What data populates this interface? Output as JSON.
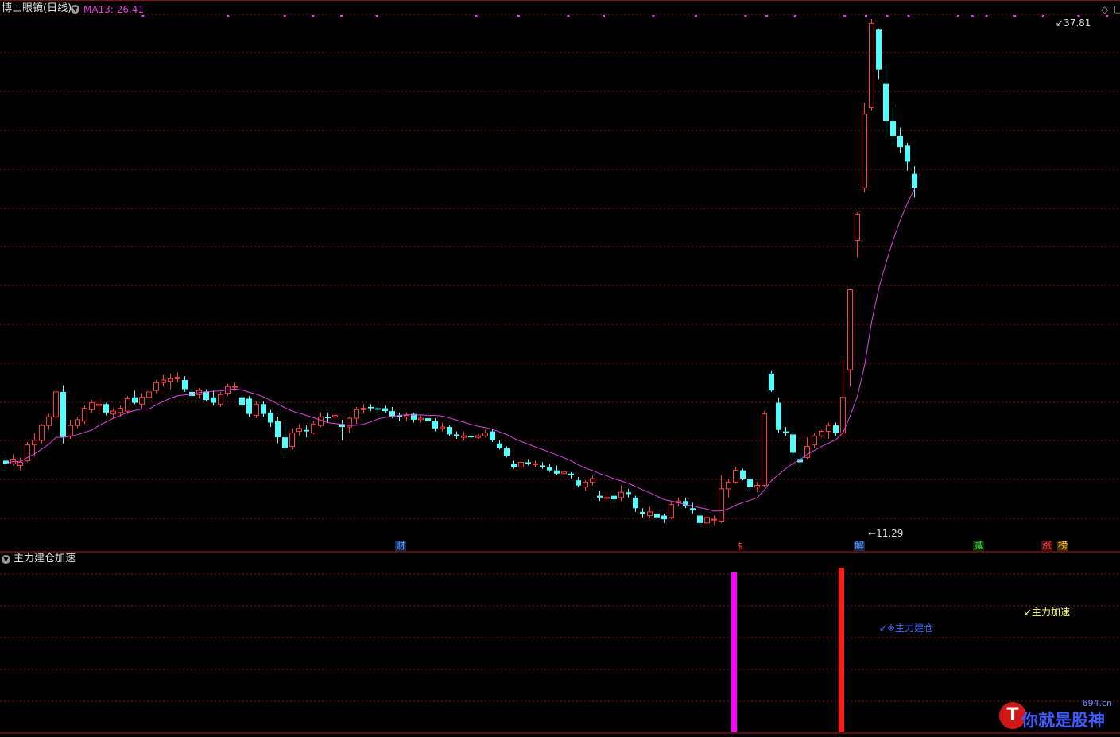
{
  "header": {
    "title": "博士眼镜(日线)",
    "ma_label": "MA13: 26.41",
    "ma_color": "#e040e0"
  },
  "sub_panel": {
    "title": "主力建仓加速"
  },
  "price_labels": {
    "high": "37.81",
    "low": "11.29"
  },
  "event_tags": [
    {
      "id": "cai",
      "text": "财",
      "color": "#5aa0ff",
      "bg": "#1a2a55"
    },
    {
      "id": "dollar",
      "text": "$",
      "color": "#ff3030",
      "bg": "#000000"
    },
    {
      "id": "jie",
      "text": "解",
      "color": "#5aa0ff",
      "bg": "#1a2a55"
    },
    {
      "id": "jian",
      "text": "减",
      "color": "#40e040",
      "bg": "#103010"
    },
    {
      "id": "zhang",
      "text": "涨",
      "color": "#ff4040",
      "bg": "#401010"
    },
    {
      "id": "bang",
      "text": "榜",
      "color": "#ffcc33",
      "bg": "#402a10"
    }
  ],
  "annotations": {
    "jiancang": "↙※主力建仓",
    "jiasu": "↙主力加速"
  },
  "watermark": {
    "main": "你就是股神",
    "site": "694.cn"
  },
  "colors": {
    "up": "#ff3c3c",
    "down": "#54ffff",
    "ma": "#e040e0",
    "grid": "#8a1010",
    "signal_build": "#ff00ff",
    "signal_accel": "#ff1a1a"
  },
  "chart_data": {
    "type": "candlestick",
    "ma_series": {
      "name": "MA13",
      "period": 13
    },
    "candles": [
      [
        12.15,
        12.25,
        11.9,
        12.05
      ],
      [
        12.05,
        12.35,
        12.0,
        12.2
      ],
      [
        12.0,
        12.25,
        11.85,
        12.1
      ],
      [
        12.15,
        12.75,
        12.1,
        12.65
      ],
      [
        12.65,
        13.05,
        12.3,
        12.8
      ],
      [
        12.8,
        13.35,
        12.7,
        13.3
      ],
      [
        13.3,
        13.7,
        13.15,
        13.6
      ],
      [
        13.6,
        14.6,
        13.5,
        14.5
      ],
      [
        14.5,
        14.75,
        12.7,
        12.9
      ],
      [
        12.95,
        13.5,
        12.85,
        13.3
      ],
      [
        13.3,
        13.6,
        13.2,
        13.5
      ],
      [
        13.45,
        14.0,
        13.35,
        13.9
      ],
      [
        13.85,
        14.2,
        13.75,
        14.1
      ],
      [
        14.0,
        14.3,
        13.7,
        14.05
      ],
      [
        14.05,
        14.1,
        13.65,
        13.75
      ],
      [
        13.7,
        13.9,
        13.55,
        13.8
      ],
      [
        13.75,
        14.0,
        13.6,
        13.9
      ],
      [
        13.8,
        14.35,
        13.7,
        14.25
      ],
      [
        14.3,
        14.55,
        14.05,
        14.1
      ],
      [
        14.05,
        14.45,
        13.9,
        14.3
      ],
      [
        14.3,
        14.55,
        14.2,
        14.5
      ],
      [
        14.55,
        14.95,
        14.45,
        14.85
      ],
      [
        14.85,
        15.15,
        14.7,
        14.95
      ],
      [
        14.9,
        15.2,
        14.6,
        15.0
      ],
      [
        15.0,
        15.25,
        14.85,
        15.05
      ],
      [
        14.95,
        15.1,
        14.5,
        14.6
      ],
      [
        14.5,
        14.7,
        14.25,
        14.35
      ],
      [
        14.4,
        14.65,
        14.25,
        14.55
      ],
      [
        14.5,
        14.6,
        14.15,
        14.2
      ],
      [
        14.3,
        14.55,
        14.0,
        14.1
      ],
      [
        14.05,
        14.5,
        13.95,
        14.4
      ],
      [
        14.45,
        14.8,
        14.35,
        14.7
      ],
      [
        14.7,
        14.85,
        14.55,
        14.7
      ],
      [
        14.3,
        14.4,
        13.9,
        14.0
      ],
      [
        14.25,
        14.35,
        13.6,
        13.7
      ],
      [
        13.65,
        14.15,
        13.55,
        14.05
      ],
      [
        14.05,
        14.15,
        13.6,
        13.7
      ],
      [
        13.75,
        13.85,
        13.25,
        13.4
      ],
      [
        13.45,
        13.6,
        12.7,
        12.9
      ],
      [
        12.9,
        13.4,
        12.4,
        12.55
      ],
      [
        12.6,
        13.2,
        12.5,
        13.05
      ],
      [
        13.1,
        13.35,
        12.95,
        13.2
      ],
      [
        13.15,
        13.3,
        12.9,
        13.1
      ],
      [
        13.05,
        13.45,
        13.0,
        13.35
      ],
      [
        13.3,
        13.75,
        13.25,
        13.6
      ],
      [
        13.6,
        13.75,
        13.4,
        13.55
      ],
      [
        13.6,
        13.75,
        13.5,
        13.65
      ],
      [
        13.35,
        13.5,
        12.8,
        13.25
      ],
      [
        13.25,
        13.6,
        13.05,
        13.55
      ],
      [
        13.55,
        13.95,
        13.35,
        13.85
      ],
      [
        13.85,
        14.05,
        13.7,
        13.9
      ],
      [
        13.95,
        14.05,
        13.8,
        13.9
      ],
      [
        13.9,
        14.0,
        13.75,
        13.85
      ],
      [
        13.9,
        14.0,
        13.75,
        13.8
      ],
      [
        13.8,
        13.95,
        13.55,
        13.6
      ],
      [
        13.65,
        13.75,
        13.45,
        13.6
      ],
      [
        13.6,
        13.75,
        13.45,
        13.65
      ],
      [
        13.7,
        13.75,
        13.4,
        13.5
      ],
      [
        13.5,
        13.65,
        13.4,
        13.55
      ],
      [
        13.55,
        13.65,
        13.4,
        13.45
      ],
      [
        13.45,
        13.55,
        13.1,
        13.2
      ],
      [
        13.2,
        13.4,
        13.1,
        13.25
      ],
      [
        13.25,
        13.3,
        12.95,
        13.0
      ],
      [
        13.0,
        13.1,
        12.85,
        12.95
      ],
      [
        12.9,
        13.1,
        12.8,
        12.95
      ],
      [
        12.95,
        13.05,
        12.85,
        12.9
      ],
      [
        12.9,
        13.0,
        12.85,
        12.95
      ],
      [
        12.95,
        13.15,
        12.9,
        13.05
      ],
      [
        13.1,
        13.2,
        12.75,
        12.8
      ],
      [
        12.7,
        12.8,
        12.5,
        12.55
      ],
      [
        12.55,
        12.6,
        12.25,
        12.3
      ],
      [
        12.05,
        12.15,
        11.9,
        11.95
      ],
      [
        11.95,
        12.2,
        11.9,
        12.1
      ],
      [
        12.1,
        12.2,
        12.0,
        12.05
      ],
      [
        12.05,
        12.15,
        11.95,
        12.05
      ],
      [
        12.0,
        12.1,
        11.9,
        11.95
      ],
      [
        11.95,
        12.05,
        11.8,
        11.85
      ],
      [
        11.85,
        12.0,
        11.7,
        11.75
      ],
      [
        11.75,
        11.85,
        11.7,
        11.8
      ],
      [
        11.75,
        11.8,
        11.6,
        11.7
      ],
      [
        11.55,
        11.65,
        11.35,
        11.4
      ],
      [
        11.35,
        11.55,
        11.25,
        11.5
      ],
      [
        11.5,
        11.7,
        11.4,
        11.6
      ],
      [
        11.1,
        11.25,
        10.95,
        11.05
      ],
      [
        11.05,
        11.15,
        10.95,
        11.05
      ],
      [
        11.1,
        11.2,
        10.9,
        11.0
      ],
      [
        11.05,
        11.4,
        10.95,
        11.2
      ],
      [
        11.2,
        11.3,
        11.05,
        11.15
      ],
      [
        11.05,
        11.1,
        10.65,
        10.75
      ],
      [
        10.65,
        10.75,
        10.5,
        10.6
      ],
      [
        10.55,
        10.8,
        10.5,
        10.65
      ],
      [
        10.6,
        10.65,
        10.45,
        10.5
      ],
      [
        10.55,
        10.6,
        10.35,
        10.45
      ],
      [
        10.5,
        10.9,
        10.45,
        10.85
      ],
      [
        10.9,
        11.05,
        10.8,
        10.95
      ],
      [
        10.95,
        11.05,
        10.75,
        10.8
      ],
      [
        10.75,
        10.9,
        10.6,
        10.7
      ],
      [
        10.55,
        10.65,
        10.3,
        10.35
      ],
      [
        10.35,
        10.55,
        10.25,
        10.5
      ],
      [
        10.45,
        10.55,
        10.3,
        10.45
      ],
      [
        10.4,
        11.7,
        10.35,
        11.3
      ],
      [
        11.3,
        11.6,
        11.05,
        11.5
      ],
      [
        11.5,
        11.95,
        11.45,
        11.85
      ],
      [
        11.85,
        11.9,
        11.55,
        11.6
      ],
      [
        11.6,
        11.7,
        11.25,
        11.35
      ],
      [
        11.35,
        11.5,
        11.2,
        11.4
      ],
      [
        11.4,
        13.8,
        11.35,
        13.7
      ],
      [
        15.2,
        15.3,
        14.5,
        14.55
      ],
      [
        14.1,
        14.3,
        13.05,
        13.15
      ],
      [
        13.1,
        13.25,
        12.95,
        13.05
      ],
      [
        13.0,
        13.2,
        12.15,
        12.4
      ],
      [
        12.2,
        12.35,
        11.95,
        12.1
      ],
      [
        12.25,
        12.9,
        12.2,
        12.6
      ],
      [
        12.65,
        13.05,
        12.55,
        12.95
      ],
      [
        12.95,
        13.15,
        12.9,
        13.1
      ],
      [
        13.1,
        13.4,
        12.85,
        13.3
      ],
      [
        13.3,
        13.4,
        12.95,
        13.05
      ],
      [
        13.05,
        15.75,
        12.95,
        14.3
      ],
      [
        15.35,
        18.9,
        14.7,
        18.85
      ],
      [
        21.4,
        23.0,
        20.5,
        22.9
      ],
      [
        24.5,
        30.5,
        24.2,
        29.6
      ],
      [
        30.1,
        37.81,
        29.9,
        37.4
      ],
      [
        36.8,
        36.9,
        32.4,
        33.2
      ],
      [
        32.0,
        33.7,
        28.1,
        29.1
      ],
      [
        29.1,
        30.2,
        27.4,
        28.0
      ],
      [
        28.0,
        28.6,
        26.8,
        27.2
      ],
      [
        27.3,
        27.5,
        25.6,
        26.2
      ],
      [
        25.4,
        25.9,
        23.9,
        24.5
      ]
    ],
    "hi_label": {
      "value": "37.81"
    },
    "lo_label": {
      "value": "11.29"
    },
    "signals": [
      {
        "name": "主力建仓",
        "index": 102,
        "color": "#ff00ff"
      },
      {
        "name": "主力加速",
        "index": 117,
        "color": "#ff1a1a"
      }
    ],
    "dot_markers": [
      20,
      32,
      40,
      44,
      48,
      53,
      67,
      73,
      80,
      85,
      92,
      98,
      105,
      108,
      112,
      119,
      122,
      125,
      128,
      135,
      137,
      139,
      143,
      147,
      152,
      156
    ]
  }
}
